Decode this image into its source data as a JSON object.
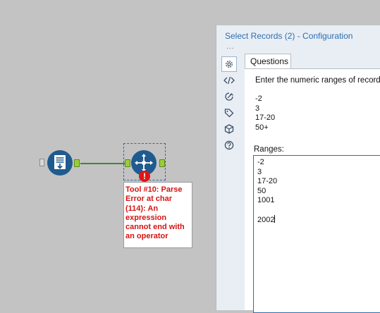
{
  "canvas": {
    "error_tooltip": [
      "Tool #10: Parse",
      "Error at char",
      "(114): An",
      "expression",
      "cannot end with",
      "an operator"
    ],
    "error_badge": "!"
  },
  "panel": {
    "title": "Select Records (2) - Configuration",
    "dots": "...",
    "tab_label": "Questions",
    "question": "Enter the numeric ranges of records",
    "example_lines": [
      "-2",
      "3",
      "17-20",
      "50+"
    ],
    "ranges_label": "Ranges:",
    "ranges_lines": [
      "-2",
      "3",
      "17-20",
      "50",
      "1001",
      "",
      "2002"
    ]
  },
  "icons": [
    "gear-icon",
    "code-icon",
    "run-icon",
    "tag-icon",
    "cube-icon",
    "help-icon"
  ],
  "colors": {
    "tool_blue": "#1f5b8e",
    "error_red": "#d81212",
    "connector_green": "#3a8a33",
    "title_blue": "#2a6fb0"
  }
}
